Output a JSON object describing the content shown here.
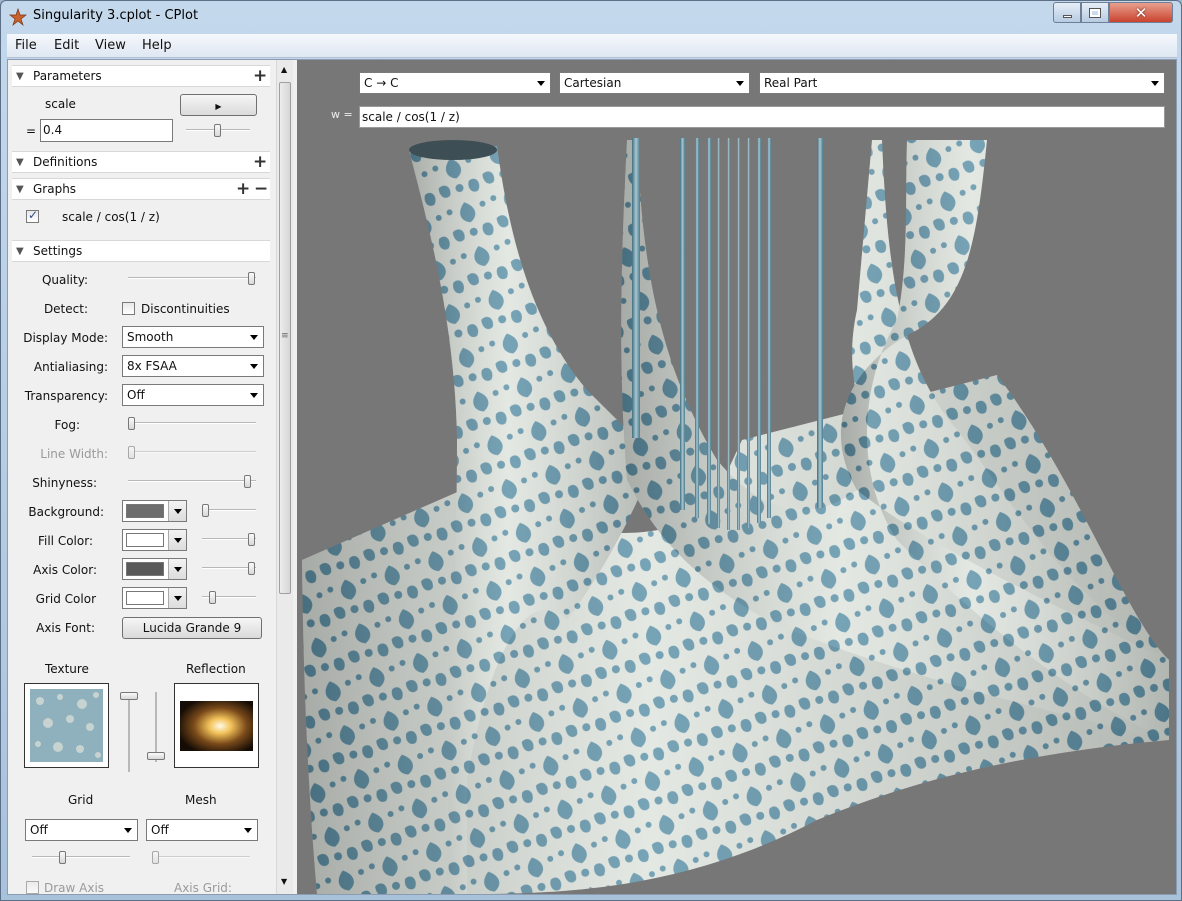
{
  "window": {
    "title": "Singularity 3.cplot - CPlot",
    "icon": "cplot-star-icon"
  },
  "menu": [
    "File",
    "Edit",
    "View",
    "Help"
  ],
  "parameters": {
    "header": "Parameters",
    "name": "scale",
    "equals": "=",
    "value": "0.4",
    "play_icon": "play-icon"
  },
  "definitions": {
    "header": "Definitions"
  },
  "graphs": {
    "header": "Graphs",
    "items": [
      {
        "label": "scale / cos(1 / z)",
        "checked": true
      }
    ]
  },
  "settings": {
    "header": "Settings",
    "quality": {
      "label": "Quality:",
      "level": 1.0
    },
    "detect": {
      "label": "Detect:",
      "checkbox_label": "Discontinuities",
      "checked": false
    },
    "display_mode": {
      "label": "Display Mode:",
      "value": "Smooth"
    },
    "antialiasing": {
      "label": "Antialiasing:",
      "value": "8x FSAA"
    },
    "transparency": {
      "label": "Transparency:",
      "value": "Off"
    },
    "fog": {
      "label": "Fog:",
      "level": 0.0
    },
    "line_width": {
      "label": "Line Width:",
      "level": 0.0
    },
    "shinyness": {
      "label": "Shinyness:",
      "level": 0.97
    },
    "background": {
      "label": "Background:",
      "color": "#6e6e6e",
      "level": 0.0
    },
    "fill_color": {
      "label": "Fill Color:",
      "color": "#ffffff",
      "level": 1.0
    },
    "axis_color": {
      "label": "Axis Color:",
      "color": "#5a5a5a",
      "level": 1.0
    },
    "grid_color": {
      "label": "Grid Color",
      "color": "#ffffff",
      "level": 0.15
    },
    "axis_font": {
      "label": "Axis Font:",
      "value": "Lucida Grande 9"
    },
    "texture_label": "Texture",
    "reflection_label": "Reflection",
    "grid": {
      "label": "Grid",
      "value": "Off",
      "level": 0.3
    },
    "mesh": {
      "label": "Mesh",
      "value": "Off",
      "level": 0.0
    },
    "draw_axis_label": "Draw Axis",
    "axis_grid_label": "Axis Grid:"
  },
  "plot": {
    "mapping": "C → C",
    "coords": "Cartesian",
    "component": "Real Part",
    "formula_label": "w =",
    "formula": "scale / cos(1 / z)",
    "background": "#777777",
    "surface_color": "#6f9db0"
  }
}
